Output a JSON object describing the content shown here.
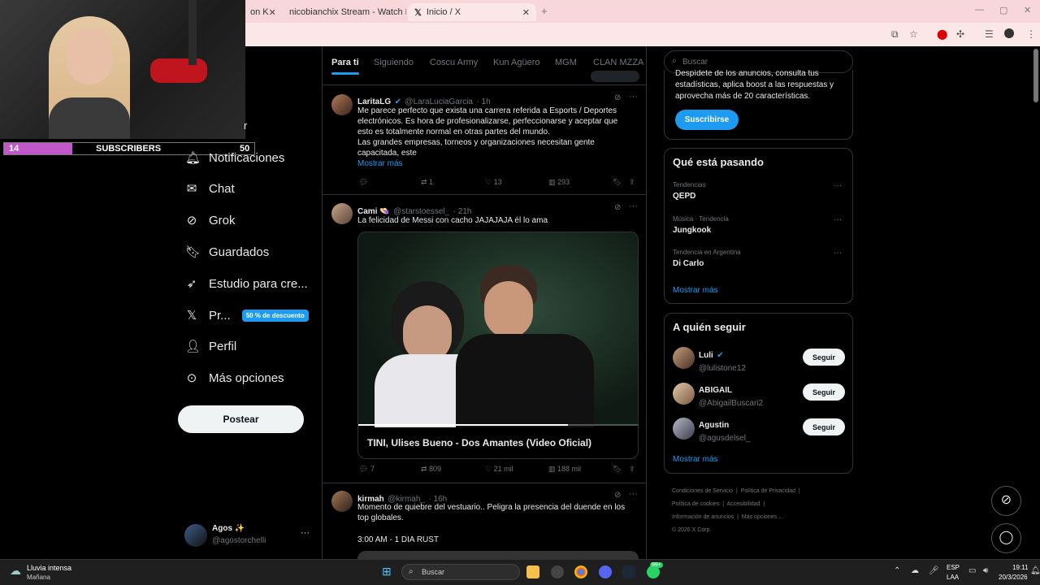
{
  "browser": {
    "tabs": [
      {
        "label": "on K"
      },
      {
        "label": "nicobianchix Stream - Watch L"
      },
      {
        "label": "Inicio / X"
      }
    ],
    "new_tab": "+"
  },
  "overlay": {
    "subs_left": "14",
    "subs_label": "SUBSCRIBERS",
    "subs_right": "50"
  },
  "nav": {
    "items": [
      {
        "icon": "bell-icon",
        "label": "Notificaciones"
      },
      {
        "icon": "mail-icon",
        "label": "Chat"
      },
      {
        "icon": "grok-icon",
        "label": "Grok"
      },
      {
        "icon": "bookmark-icon",
        "label": "Guardados"
      },
      {
        "icon": "rocket-icon",
        "label": "Estudio para cre..."
      },
      {
        "icon": "x-logo-icon",
        "label": "Pr..."
      },
      {
        "icon": "person-icon",
        "label": "Perfil"
      },
      {
        "icon": "more-circle-icon",
        "label": "Más opciones"
      }
    ],
    "premium_badge": "50 % de descuento",
    "post_button": "Postear",
    "partial_label": "r",
    "account": {
      "name": "Agos ✨",
      "handle": "@agostorchelli",
      "more": "···"
    }
  },
  "feed": {
    "tabs": [
      "Para ti",
      "Siguiendo",
      "Coscu Army",
      "Kun Agüero",
      "MGM",
      "CLAN MZZA"
    ],
    "tweets": [
      {
        "name": "LaritaLG",
        "handle": "@LaraLuciaGarcia",
        "time": "· 1h",
        "text": "Me parece perfecto que exista una carrera referida a Esports / Deportes electrónicos. Es hora de profesionalizarse, perfeccionarse y aceptar que esto es totalmente normal en otras partes del mundo.",
        "text2": "Las grandes empresas, torneos y organizaciones necesitan gente capacitada, este",
        "more": "Mostrar más",
        "retweets": "1",
        "likes": "13",
        "views": "293"
      },
      {
        "name": "Cami 👒",
        "handle": "@starstoessel_",
        "time": "· 21h",
        "text": "La felicidad de Messi con cacho JAJAJAJA él lo ama",
        "video_title": "TINI, Ulises Bueno - Dos Amantes (Video Oficial)",
        "video_progress": 0.75,
        "replies": "7",
        "retweets": "809",
        "likes": "21 mil",
        "views": "188 mil"
      },
      {
        "name": "kirmah",
        "handle": "@kirmah_",
        "time": "· 16h",
        "text": "Momento de quiebre del vestuario.. Peligra la presencia del duende en los top globales.",
        "text2": "3:00 AM - 1 DIA RUST"
      }
    ]
  },
  "sidebar": {
    "search_placeholder": "Buscar",
    "premium_text": "Despídete de los anuncios, consulta tus estadísticas, aplica boost a las respuestas y aprovecha más de 20 características.",
    "subscribe": "Suscribirse",
    "trends_title": "Qué está pasando",
    "trends": [
      {
        "context": "Tendencias",
        "name": "QEPD"
      },
      {
        "context": "Música · Tendencia",
        "name": "Jungkook"
      },
      {
        "context": "Tendencia en Argentina",
        "name": "Di Carlo"
      }
    ],
    "trends_more": "Mostrar más",
    "follow_title": "A quién seguir",
    "follow": [
      {
        "name": "Luli",
        "handle": "@lulistone12",
        "button": "Seguir"
      },
      {
        "name": "ABIGAIL",
        "handle": "@AbigailBuscari2",
        "button": "Seguir"
      },
      {
        "name": "Agustin",
        "handle": "@agusdelsel_",
        "button": "Seguir"
      }
    ],
    "follow_more": "Mostrar más",
    "footer": [
      "Condiciones de Servicio",
      "Política de Privacidad",
      "Política de cookies",
      "Accesibilidad",
      "Información de anuncios",
      "Más opciones ...",
      "© 2026 X Corp."
    ]
  },
  "taskbar": {
    "weather_title": "Lluvia intensa",
    "weather_sub": "Mañana",
    "search": "Buscar",
    "lang1": "ESP",
    "lang2": "LAA",
    "time": "19:11",
    "date": "20/3/2026",
    "badge": "99+"
  }
}
